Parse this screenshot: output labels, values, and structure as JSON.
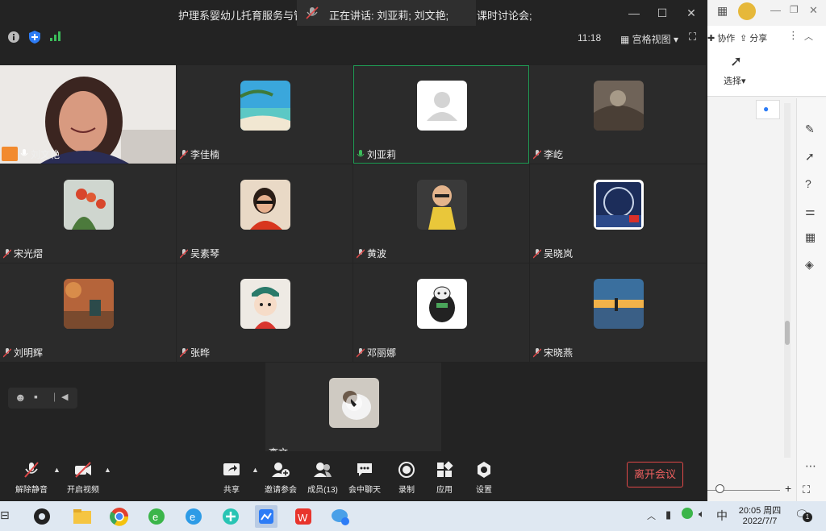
{
  "window": {
    "title": "护理系婴幼儿托育服务与管",
    "speaking": "正在讲话: 刘亚莉; 刘文艳;",
    "title_tail": "课时讨论会;",
    "clock": "11:18",
    "view_mode": "宫格视图"
  },
  "tiles": [
    {
      "name": "刘文艳",
      "speaking": true
    },
    {
      "name": "李佳楠"
    },
    {
      "name": "刘亚莉",
      "active": true
    },
    {
      "name": "李屹"
    },
    {
      "name": "宋光熠"
    },
    {
      "name": "吴素琴"
    },
    {
      "name": "黄波"
    },
    {
      "name": "吴晓岚"
    },
    {
      "name": "刘明辉"
    },
    {
      "name": "张晔"
    },
    {
      "name": "邓丽娜"
    },
    {
      "name": "宋晓燕"
    },
    {
      "name": "李文"
    }
  ],
  "bottombar": {
    "mute": "解除静音",
    "video": "开启视频",
    "share": "共享",
    "invite": "邀请参会",
    "members": "成员(13)",
    "chat": "会中聊天",
    "record": "录制",
    "apps": "应用",
    "settings": "设置",
    "leave": "离开会议"
  },
  "right_panel": {
    "collab": "协作",
    "share": "分享",
    "select": "选择"
  },
  "taskbar": {
    "time": "20:05 周四",
    "date": "2022/7/7",
    "ime": "中",
    "notif_count": "1"
  },
  "colors": {
    "accent_green": "#1f9e55",
    "leave_red": "#e04848",
    "bg_dark": "#232323"
  }
}
